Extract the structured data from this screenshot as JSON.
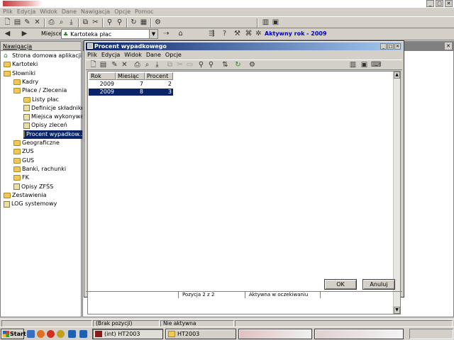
{
  "app": {
    "menu": [
      "Plik",
      "Edycja",
      "Widok",
      "Dane",
      "Nawigacja",
      "Opcje",
      "Pomoc"
    ],
    "location_label": "Miejsce",
    "location_value": "Kartoteka płac",
    "active_year": "Aktywny rok - 2009"
  },
  "nav": {
    "header": "Nawigacja",
    "items": [
      {
        "label": "Strona domowa aplikacji",
        "icon": "home-icon",
        "indent": 0
      },
      {
        "label": "Kartoteki",
        "icon": "folder-icon",
        "indent": 0
      },
      {
        "label": "Słowniki",
        "icon": "folder-icon",
        "indent": 0
      },
      {
        "label": "Kadry",
        "icon": "folder-icon",
        "indent": 1
      },
      {
        "label": "Płace / Zlecenia",
        "icon": "folder-icon",
        "indent": 1
      },
      {
        "label": "Listy płac",
        "icon": "folder-icon",
        "indent": 2
      },
      {
        "label": "Definicje składnikó...",
        "icon": "document-icon",
        "indent": 2
      },
      {
        "label": "Miejsca wykonywa...",
        "icon": "document-icon",
        "indent": 2
      },
      {
        "label": "Opisy zleceń",
        "icon": "document-icon",
        "indent": 2
      },
      {
        "label": "Procent wypadkow...",
        "icon": "document-icon",
        "indent": 2,
        "selected": true
      },
      {
        "label": "Geograficzne",
        "icon": "folder-icon",
        "indent": 1
      },
      {
        "label": "ZUS",
        "icon": "folder-icon",
        "indent": 1
      },
      {
        "label": "GUS",
        "icon": "folder-icon",
        "indent": 1
      },
      {
        "label": "Banki, rachunki",
        "icon": "folder-icon",
        "indent": 1
      },
      {
        "label": "FK",
        "icon": "folder-icon",
        "indent": 1
      },
      {
        "label": "Opisy ZFŚS",
        "icon": "document-icon",
        "indent": 1
      },
      {
        "label": "Zestawienia",
        "icon": "folder-icon",
        "indent": 0
      },
      {
        "label": "LOG systemowy",
        "icon": "document-icon",
        "indent": 0
      }
    ]
  },
  "dialog": {
    "title": "Procent wypadkowego",
    "menu": [
      "Plik",
      "Edycja",
      "Widok",
      "Dane",
      "Opcje"
    ],
    "columns": [
      "Rok",
      "Miesiąc",
      "Procent"
    ],
    "rows": [
      {
        "rok": "2009",
        "miesiac": "7",
        "procent": "2",
        "selected": false
      },
      {
        "rok": "2009",
        "miesiac": "8",
        "procent": "3",
        "selected": true
      }
    ],
    "ok_label": "OK",
    "cancel_label": "Anuluj",
    "status_position": "Pozycja 2 z 2",
    "status_state": "Aktywna w oczekiwaniu"
  },
  "status": {
    "position": "(Brak pozycji)",
    "state": "Nie aktywna"
  },
  "taskbar": {
    "start": "Start",
    "tasks": [
      "(int) HT2003",
      "HT2003"
    ]
  }
}
